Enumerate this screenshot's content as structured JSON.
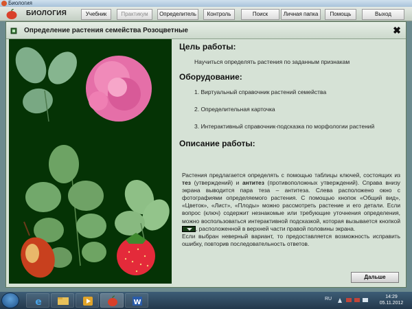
{
  "window": {
    "title": "Биология"
  },
  "app": {
    "name": "БИОЛОГИЯ"
  },
  "menu": {
    "items": [
      {
        "label": "Учебник",
        "disabled": false
      },
      {
        "label": "Практикум",
        "disabled": true
      },
      {
        "label": "Определитель",
        "disabled": false
      },
      {
        "label": "Контроль",
        "disabled": false
      },
      {
        "label": "Поиск",
        "disabled": false
      },
      {
        "label": "Личная папка",
        "disabled": false
      },
      {
        "label": "Помощь",
        "disabled": false
      },
      {
        "label": "Выход",
        "disabled": false
      }
    ]
  },
  "panel": {
    "title": "Определение растения семейства Розоцветные"
  },
  "content": {
    "goal_heading": "Цель работы:",
    "goal_text": "Научиться определять растения по заданным признакам",
    "equipment_heading": "Оборудование:",
    "equipment": [
      "1. Виртуальный справочник растений семейства",
      "2. Определительная карточка",
      "3. Интерактивный справочник-подсказка по морфологии растений"
    ],
    "description_heading": "Описание работы:",
    "desc_1": "Растения предлагается определять с помощью таблицы ключей, состоящих из ",
    "desc_tez": "тез",
    "desc_2": " (утверждений) и ",
    "desc_antitez": "антитез",
    "desc_3": " (противоположных утверждений). Справа внизу экрана выводится пара теза – антитеза. Слева расположено окно с фотографиями определяемого растения. С помощью кнопок «Общий вид», «Цветок», «Лист», «Плоды» можно рассмотреть растение и его детали. Если вопрос (ключ) содержит незнакомые или требующие уточнения определения, можно воспользоваться интерактивной подсказкой, которая вызывается кнопкой ",
    "desc_4": ", расположенной в верхней части правой половины экрана.",
    "desc_5": "Если выбран неверный вариант, то предоставляется возможность исправить ошибку, повторив последовательность ответов.",
    "next_button": "Дальше"
  },
  "taskbar": {
    "lang": "RU",
    "time": "14:29",
    "date": "05.11.2012"
  },
  "colors": {
    "panel_bg": "#d6e2d6",
    "photo_bg": "#053305",
    "taskbar": "#23384c"
  }
}
